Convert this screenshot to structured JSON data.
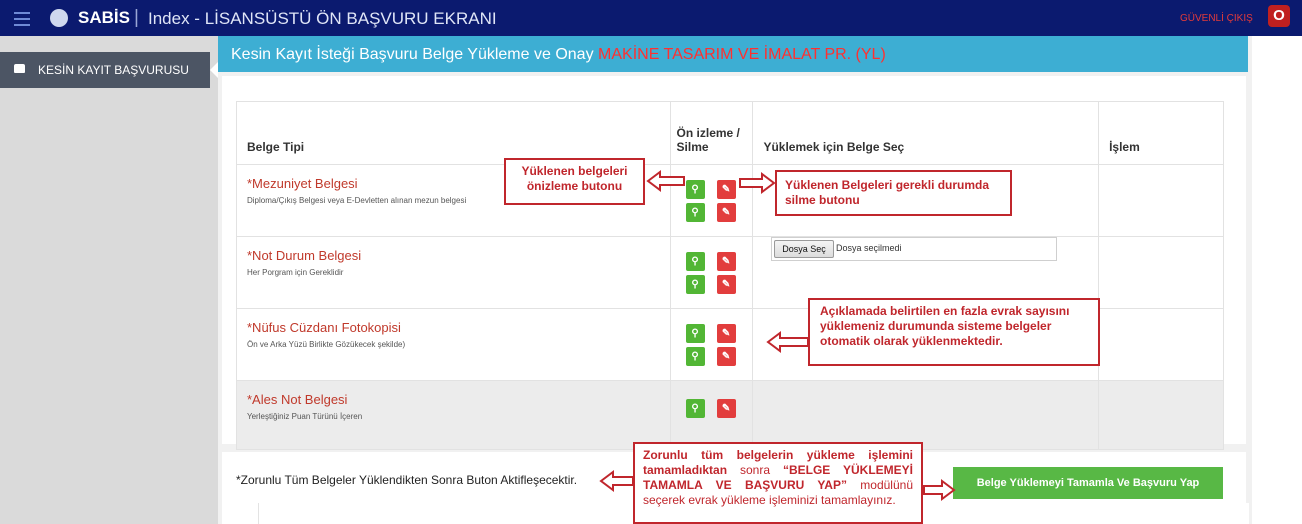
{
  "topbar": {
    "brand": "SABİS",
    "separator": "|",
    "title": "Index - LİSANSÜSTÜ ÖN BAŞVURU EKRANI",
    "logout_label": "GÜVENLİ ÇIKIŞ",
    "power_icon_glyph": "O"
  },
  "sidebar": {
    "items": [
      {
        "label": "KESİN KAYIT BAŞVURUSU",
        "icon": "thumbs-up-icon"
      }
    ]
  },
  "header": {
    "title": "Kesin Kayıt İsteği Başvuru Belge Yükleme ve Onay",
    "program": "MAKİNE TASARIM VE İMALAT PR. (YL)"
  },
  "table": {
    "columns": [
      "Belge Tipi",
      "Ön izleme / Silme",
      "Yüklemek için Belge Seç",
      "İşlem"
    ],
    "rows": [
      {
        "name": "*Mezuniyet Belgesi",
        "desc": "Diploma/Çıkış Belgesi veya E-Devletten alınan mezun belgesi"
      },
      {
        "name": "*Not Durum Belgesi",
        "desc": "Her Porgram için Gereklidir"
      },
      {
        "name": "*Nüfus Cüzdanı Fotokopisi",
        "desc": "Ön ve Arka Yüzü Birlikte Gözükecek şekilde)"
      },
      {
        "name": "*Ales Not Belgesi",
        "desc": "Yerleştiğiniz Puan Türünü İçeren"
      }
    ]
  },
  "file_input": {
    "button": "Dosya Seç",
    "status": "Dosya seçilmedi"
  },
  "footer": {
    "note": "*Zorunlu Tüm Belgeler Yüklendikten Sonra Buton Aktifleşecektir.",
    "submit_label": "Belge Yüklemeyi Tamamla Ve Başvuru Yap"
  },
  "annotations": {
    "preview": "Yüklenen belgeleri önizleme butonu",
    "delete": "Yüklenen Belgeleri gerekli durumda silme butonu",
    "auto_upload": "Açıklamada belirtilen en fazla evrak sayısını yüklemeniz durumunda sisteme belgeler otomatik olarak yüklenmektedir.",
    "complete_a": "Zorunlu tüm belgelerin yükleme işlemini ",
    "complete_b": "tamamladıktan",
    "complete_c": " sonra ",
    "complete_d": "“BELGE YÜKLEMEYİ TAMAMLA VE BAŞVURU YAP”",
    "complete_e": " modülünü seçerek evrak yükleme işleminizi tamamlayınız."
  },
  "colors": {
    "topbar": "#0b1a6f",
    "header": "#3daed3",
    "accent_red": "#ff3030",
    "preview_button": "#52b635",
    "delete_button": "#e23d3d",
    "submit_button": "#58b845",
    "annotation": "#c0262c"
  }
}
